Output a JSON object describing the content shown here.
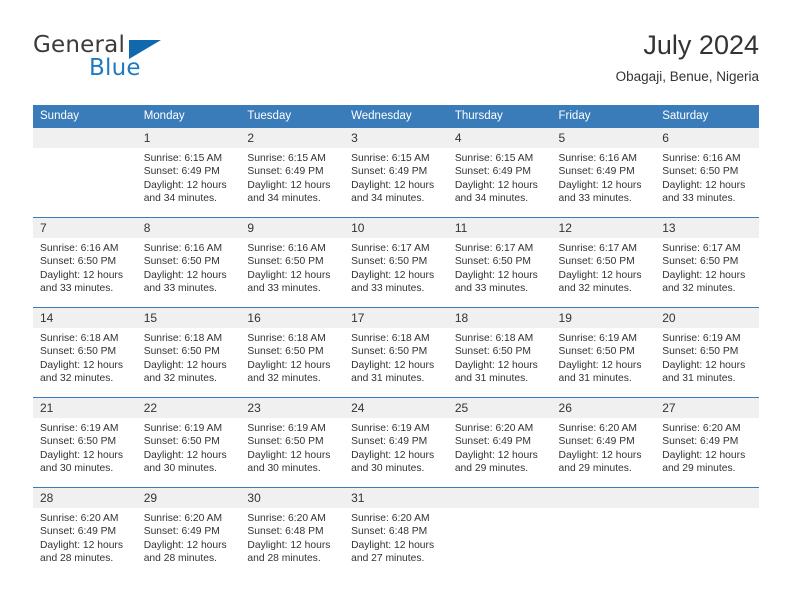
{
  "brand": {
    "name_part1": "General",
    "name_part2": "Blue",
    "logo_icon": "triangle-logo-icon",
    "accent_color": "#1268ad"
  },
  "header": {
    "title": "July 2024",
    "location": "Obagaji, Benue, Nigeria"
  },
  "theme": {
    "header_blue": "#3a7cb9",
    "daynum_gray": "#f0f0f0",
    "text_color": "#333333"
  },
  "calendar": {
    "weekday_headers": [
      "Sunday",
      "Monday",
      "Tuesday",
      "Wednesday",
      "Thursday",
      "Friday",
      "Saturday"
    ],
    "labels": {
      "sunrise_prefix": "Sunrise:",
      "sunset_prefix": "Sunset:",
      "daylight_prefix": "Daylight:"
    },
    "weeks": [
      [
        {
          "day": "",
          "empty": true
        },
        {
          "day": "1",
          "sunrise": "Sunrise: 6:15 AM",
          "sunset": "Sunset: 6:49 PM",
          "daylight_line1": "Daylight: 12 hours",
          "daylight_line2": "and 34 minutes."
        },
        {
          "day": "2",
          "sunrise": "Sunrise: 6:15 AM",
          "sunset": "Sunset: 6:49 PM",
          "daylight_line1": "Daylight: 12 hours",
          "daylight_line2": "and 34 minutes."
        },
        {
          "day": "3",
          "sunrise": "Sunrise: 6:15 AM",
          "sunset": "Sunset: 6:49 PM",
          "daylight_line1": "Daylight: 12 hours",
          "daylight_line2": "and 34 minutes."
        },
        {
          "day": "4",
          "sunrise": "Sunrise: 6:15 AM",
          "sunset": "Sunset: 6:49 PM",
          "daylight_line1": "Daylight: 12 hours",
          "daylight_line2": "and 34 minutes."
        },
        {
          "day": "5",
          "sunrise": "Sunrise: 6:16 AM",
          "sunset": "Sunset: 6:49 PM",
          "daylight_line1": "Daylight: 12 hours",
          "daylight_line2": "and 33 minutes."
        },
        {
          "day": "6",
          "sunrise": "Sunrise: 6:16 AM",
          "sunset": "Sunset: 6:50 PM",
          "daylight_line1": "Daylight: 12 hours",
          "daylight_line2": "and 33 minutes."
        }
      ],
      [
        {
          "day": "7",
          "sunrise": "Sunrise: 6:16 AM",
          "sunset": "Sunset: 6:50 PM",
          "daylight_line1": "Daylight: 12 hours",
          "daylight_line2": "and 33 minutes."
        },
        {
          "day": "8",
          "sunrise": "Sunrise: 6:16 AM",
          "sunset": "Sunset: 6:50 PM",
          "daylight_line1": "Daylight: 12 hours",
          "daylight_line2": "and 33 minutes."
        },
        {
          "day": "9",
          "sunrise": "Sunrise: 6:16 AM",
          "sunset": "Sunset: 6:50 PM",
          "daylight_line1": "Daylight: 12 hours",
          "daylight_line2": "and 33 minutes."
        },
        {
          "day": "10",
          "sunrise": "Sunrise: 6:17 AM",
          "sunset": "Sunset: 6:50 PM",
          "daylight_line1": "Daylight: 12 hours",
          "daylight_line2": "and 33 minutes."
        },
        {
          "day": "11",
          "sunrise": "Sunrise: 6:17 AM",
          "sunset": "Sunset: 6:50 PM",
          "daylight_line1": "Daylight: 12 hours",
          "daylight_line2": "and 33 minutes."
        },
        {
          "day": "12",
          "sunrise": "Sunrise: 6:17 AM",
          "sunset": "Sunset: 6:50 PM",
          "daylight_line1": "Daylight: 12 hours",
          "daylight_line2": "and 32 minutes."
        },
        {
          "day": "13",
          "sunrise": "Sunrise: 6:17 AM",
          "sunset": "Sunset: 6:50 PM",
          "daylight_line1": "Daylight: 12 hours",
          "daylight_line2": "and 32 minutes."
        }
      ],
      [
        {
          "day": "14",
          "sunrise": "Sunrise: 6:18 AM",
          "sunset": "Sunset: 6:50 PM",
          "daylight_line1": "Daylight: 12 hours",
          "daylight_line2": "and 32 minutes."
        },
        {
          "day": "15",
          "sunrise": "Sunrise: 6:18 AM",
          "sunset": "Sunset: 6:50 PM",
          "daylight_line1": "Daylight: 12 hours",
          "daylight_line2": "and 32 minutes."
        },
        {
          "day": "16",
          "sunrise": "Sunrise: 6:18 AM",
          "sunset": "Sunset: 6:50 PM",
          "daylight_line1": "Daylight: 12 hours",
          "daylight_line2": "and 32 minutes."
        },
        {
          "day": "17",
          "sunrise": "Sunrise: 6:18 AM",
          "sunset": "Sunset: 6:50 PM",
          "daylight_line1": "Daylight: 12 hours",
          "daylight_line2": "and 31 minutes."
        },
        {
          "day": "18",
          "sunrise": "Sunrise: 6:18 AM",
          "sunset": "Sunset: 6:50 PM",
          "daylight_line1": "Daylight: 12 hours",
          "daylight_line2": "and 31 minutes."
        },
        {
          "day": "19",
          "sunrise": "Sunrise: 6:19 AM",
          "sunset": "Sunset: 6:50 PM",
          "daylight_line1": "Daylight: 12 hours",
          "daylight_line2": "and 31 minutes."
        },
        {
          "day": "20",
          "sunrise": "Sunrise: 6:19 AM",
          "sunset": "Sunset: 6:50 PM",
          "daylight_line1": "Daylight: 12 hours",
          "daylight_line2": "and 31 minutes."
        }
      ],
      [
        {
          "day": "21",
          "sunrise": "Sunrise: 6:19 AM",
          "sunset": "Sunset: 6:50 PM",
          "daylight_line1": "Daylight: 12 hours",
          "daylight_line2": "and 30 minutes."
        },
        {
          "day": "22",
          "sunrise": "Sunrise: 6:19 AM",
          "sunset": "Sunset: 6:50 PM",
          "daylight_line1": "Daylight: 12 hours",
          "daylight_line2": "and 30 minutes."
        },
        {
          "day": "23",
          "sunrise": "Sunrise: 6:19 AM",
          "sunset": "Sunset: 6:50 PM",
          "daylight_line1": "Daylight: 12 hours",
          "daylight_line2": "and 30 minutes."
        },
        {
          "day": "24",
          "sunrise": "Sunrise: 6:19 AM",
          "sunset": "Sunset: 6:49 PM",
          "daylight_line1": "Daylight: 12 hours",
          "daylight_line2": "and 30 minutes."
        },
        {
          "day": "25",
          "sunrise": "Sunrise: 6:20 AM",
          "sunset": "Sunset: 6:49 PM",
          "daylight_line1": "Daylight: 12 hours",
          "daylight_line2": "and 29 minutes."
        },
        {
          "day": "26",
          "sunrise": "Sunrise: 6:20 AM",
          "sunset": "Sunset: 6:49 PM",
          "daylight_line1": "Daylight: 12 hours",
          "daylight_line2": "and 29 minutes."
        },
        {
          "day": "27",
          "sunrise": "Sunrise: 6:20 AM",
          "sunset": "Sunset: 6:49 PM",
          "daylight_line1": "Daylight: 12 hours",
          "daylight_line2": "and 29 minutes."
        }
      ],
      [
        {
          "day": "28",
          "sunrise": "Sunrise: 6:20 AM",
          "sunset": "Sunset: 6:49 PM",
          "daylight_line1": "Daylight: 12 hours",
          "daylight_line2": "and 28 minutes."
        },
        {
          "day": "29",
          "sunrise": "Sunrise: 6:20 AM",
          "sunset": "Sunset: 6:49 PM",
          "daylight_line1": "Daylight: 12 hours",
          "daylight_line2": "and 28 minutes."
        },
        {
          "day": "30",
          "sunrise": "Sunrise: 6:20 AM",
          "sunset": "Sunset: 6:48 PM",
          "daylight_line1": "Daylight: 12 hours",
          "daylight_line2": "and 28 minutes."
        },
        {
          "day": "31",
          "sunrise": "Sunrise: 6:20 AM",
          "sunset": "Sunset: 6:48 PM",
          "daylight_line1": "Daylight: 12 hours",
          "daylight_line2": "and 27 minutes."
        },
        {
          "day": "",
          "empty": true
        },
        {
          "day": "",
          "empty": true
        },
        {
          "day": "",
          "empty": true
        }
      ]
    ]
  }
}
